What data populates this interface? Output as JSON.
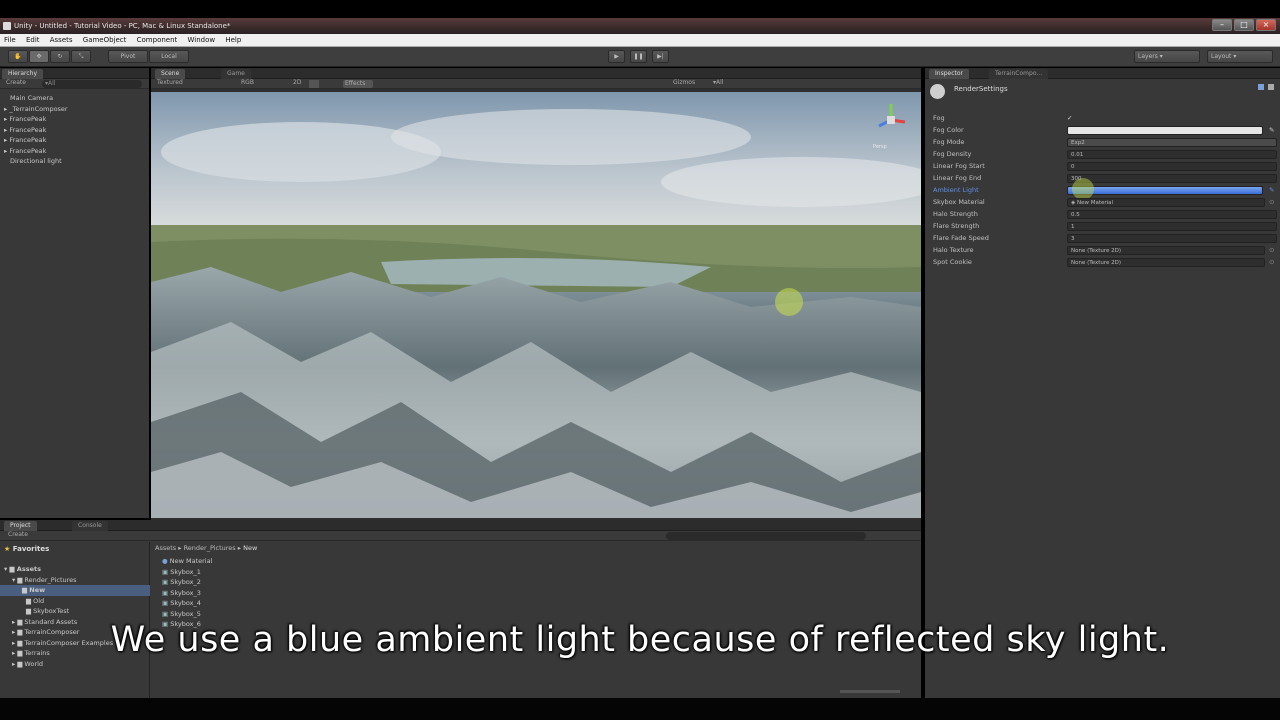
{
  "window": {
    "title": "Unity - Untitled - Tutorial Video - PC, Mac & Linux Standalone*"
  },
  "menu": [
    "File",
    "Edit",
    "Assets",
    "GameObject",
    "Component",
    "Window",
    "Help"
  ],
  "toolbar": {
    "pivot": "Pivot",
    "local": "Local",
    "layers": "Layers",
    "layout": "Layout"
  },
  "hierarchy": {
    "tab": "Hierarchy",
    "create": "Create",
    "search": "▾All",
    "items": [
      "Main Camera",
      "_TerrainComposer",
      "FrancePeak",
      "FrancePeak",
      "FrancePeak",
      "FrancePeak",
      "Directional light"
    ]
  },
  "scene": {
    "tab_scene": "Scene",
    "tab_game": "Game",
    "shading": "Textured",
    "rgb": "RGB",
    "mode_2d": "2D",
    "effects": "Effects",
    "gizmos": "Gizmos",
    "search": "▾All",
    "persp": "Persp"
  },
  "inspector": {
    "tab_inspector": "Inspector",
    "tab_terrain": "TerrainCompo...",
    "header": "RenderSettings",
    "rows": [
      {
        "label": "Fog",
        "value": "✓",
        "type": "check"
      },
      {
        "label": "Fog Color",
        "value": "",
        "type": "color-white"
      },
      {
        "label": "Fog Mode",
        "value": "Exp2",
        "type": "dropdown"
      },
      {
        "label": "Fog Density",
        "value": "0.01",
        "type": "field"
      },
      {
        "label": "Linear Fog Start",
        "value": "0",
        "type": "field"
      },
      {
        "label": "Linear Fog End",
        "value": "300",
        "type": "field"
      },
      {
        "label": "Ambient Light",
        "value": "",
        "type": "color-blue"
      },
      {
        "label": "Skybox Material",
        "value": "New Material",
        "type": "object"
      },
      {
        "label": "Halo Strength",
        "value": "0.5",
        "type": "field"
      },
      {
        "label": "Flare Strength",
        "value": "1",
        "type": "field"
      },
      {
        "label": "Flare Fade Speed",
        "value": "3",
        "type": "field"
      },
      {
        "label": "Halo Texture",
        "value": "None (Texture 2D)",
        "type": "object"
      },
      {
        "label": "Spot Cookie",
        "value": "None (Texture 2D)",
        "type": "object"
      }
    ],
    "colors": {
      "ambient": "#3b6fd8",
      "fog": "#e6e6e6"
    }
  },
  "project": {
    "tab_project": "Project",
    "tab_console": "Console",
    "create": "Create",
    "favorites": "Favorites",
    "tree": [
      {
        "label": "Assets",
        "indent": 0,
        "bold": true
      },
      {
        "label": "Render_Pictures",
        "indent": 1,
        "bold": false
      },
      {
        "label": "New",
        "indent": 2,
        "bold": true,
        "selected": true
      },
      {
        "label": "Old",
        "indent": 2,
        "bold": false
      },
      {
        "label": "SkyboxTest",
        "indent": 2,
        "bold": false
      },
      {
        "label": "Standard Assets",
        "indent": 1,
        "bold": false
      },
      {
        "label": "TerrainComposer",
        "indent": 1,
        "bold": false
      },
      {
        "label": "TerrainComposer Examples",
        "indent": 1,
        "bold": false
      },
      {
        "label": "Terrains",
        "indent": 1,
        "bold": false
      },
      {
        "label": "World",
        "indent": 1,
        "bold": false
      }
    ],
    "breadcrumb": [
      "Assets",
      "Render_Pictures",
      "New"
    ],
    "files": [
      "New Material",
      "Skybox_1",
      "Skybox_2",
      "Skybox_3",
      "Skybox_4",
      "Skybox_5",
      "Skybox_6"
    ]
  },
  "caption": "We use a blue ambient light because of reflected sky light."
}
